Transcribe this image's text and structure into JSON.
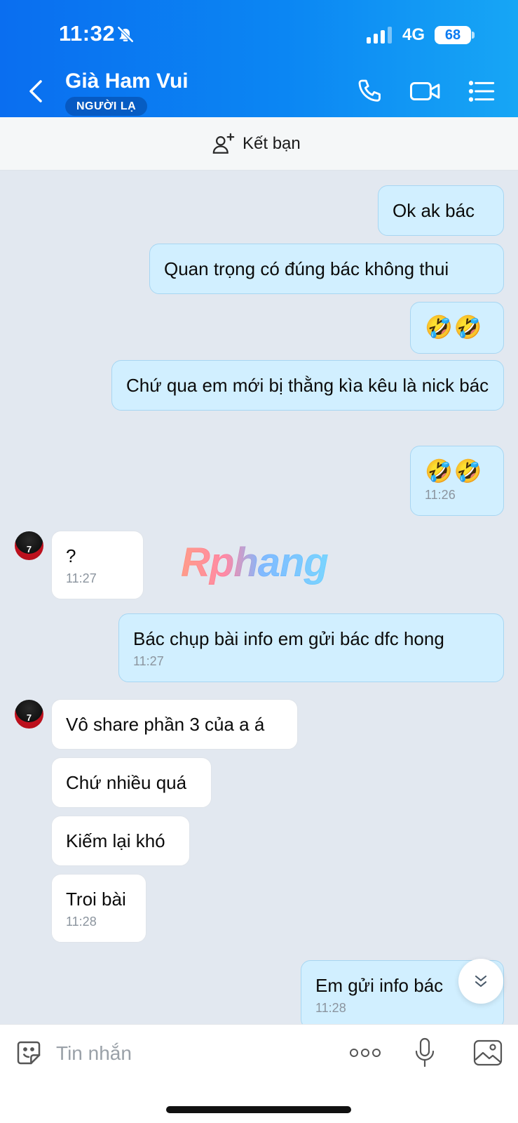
{
  "status_bar": {
    "time": "11:32",
    "network": "4G",
    "battery": "68"
  },
  "header": {
    "contact_name": "Già Ham Vui",
    "badge": "NGƯỜI LẠ"
  },
  "add_friend": {
    "label": "Kết bạn"
  },
  "watermark": "Rphang",
  "messages": [
    {
      "id": "m1",
      "side": "out",
      "text": "Ok ak bác",
      "time": ""
    },
    {
      "id": "m2",
      "side": "out",
      "text": "Quan trọng có đúng bác không thui",
      "time": ""
    },
    {
      "id": "m3",
      "side": "out",
      "text": "🤣🤣",
      "time": ""
    },
    {
      "id": "m4",
      "side": "out",
      "text": "Chứ qua em mới bị thằng kìa kêu là nick bác",
      "time": ""
    },
    {
      "id": "m5",
      "side": "out",
      "text": "🤣🤣",
      "time": "11:26"
    },
    {
      "id": "m6",
      "side": "in",
      "text": "?",
      "time": "11:27"
    },
    {
      "id": "m7",
      "side": "out",
      "text": "Bác chụp bài info em gửi bác dfc hong",
      "time": "11:27"
    },
    {
      "id": "m8",
      "side": "in",
      "text": "Vô share phần 3 của a á",
      "time": ""
    },
    {
      "id": "m9",
      "side": "in",
      "text": "Chứ nhiều quá",
      "time": ""
    },
    {
      "id": "m10",
      "side": "in",
      "text": "Kiếm lại khó",
      "time": ""
    },
    {
      "id": "m11",
      "side": "in",
      "text": "Troi bài",
      "time": "11:28"
    },
    {
      "id": "m12",
      "side": "out",
      "text": "Em gửi info bác",
      "time": "11:28"
    }
  ],
  "avatar_text": "7",
  "composer": {
    "placeholder": "Tin nhắn"
  },
  "colors": {
    "header_start": "#0a6ef0",
    "header_end": "#17a6f5",
    "outgoing_bubble": "#d1efff",
    "incoming_bubble": "#ffffff",
    "chat_bg": "#e2e8f0"
  },
  "icons": [
    "back-icon",
    "phone-icon",
    "video-icon",
    "menu-icon",
    "add-person-icon",
    "sticker-icon",
    "more-icon",
    "mic-icon",
    "image-icon",
    "chevron-down-icon",
    "bell-off-icon",
    "signal-icon"
  ]
}
